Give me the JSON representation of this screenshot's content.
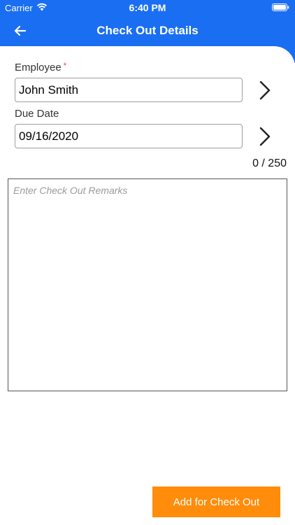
{
  "status_bar": {
    "carrier": "Carrier",
    "time": "6:40 PM"
  },
  "nav": {
    "title": "Check Out Details",
    "back_icon": "arrow-left-icon"
  },
  "form": {
    "employee": {
      "label": "Employee",
      "required_mark": "*",
      "value": "John Smith"
    },
    "due_date": {
      "label": "Due Date",
      "value": "09/16/2020"
    },
    "remarks": {
      "counter": "0 / 250",
      "placeholder": "Enter Check Out Remarks"
    }
  },
  "actions": {
    "submit_label": "Add for Check Out"
  },
  "colors": {
    "header": "#1a6ef2",
    "button": "#ff8c0a",
    "required": "#e53935"
  }
}
